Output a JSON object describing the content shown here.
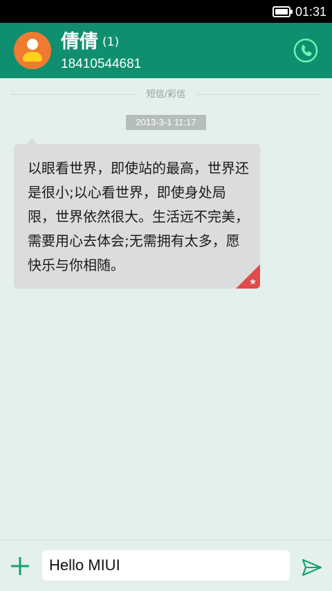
{
  "status_bar": {
    "time": "01:31",
    "battery_icon": "battery-icon"
  },
  "header": {
    "contact_name": "倩倩",
    "message_count": "(1)",
    "phone_number": "18410544681",
    "avatar_icon": "person-avatar-icon",
    "call_icon": "phone-icon"
  },
  "thread": {
    "channel_label": "短信/彩信",
    "timestamp": "2013-3-1 11:17",
    "message": {
      "text": "以眼看世界，即使站的最高，世界还是很小;以心看世界，即使身处局限，世界依然很大。生活远不完美，需要用心去体会;无需拥有太多，愿快乐与你相随。",
      "starred_icon": "star-icon"
    }
  },
  "composer": {
    "input_value": "Hello MIUI",
    "attach_icon": "plus-icon",
    "send_icon": "send-icon"
  },
  "colors": {
    "header": "#0f8f6f",
    "background": "#e3f0ec",
    "bubble": "#dcdcdc",
    "star_corner": "#e24b4b",
    "avatar": "#f07a32"
  }
}
